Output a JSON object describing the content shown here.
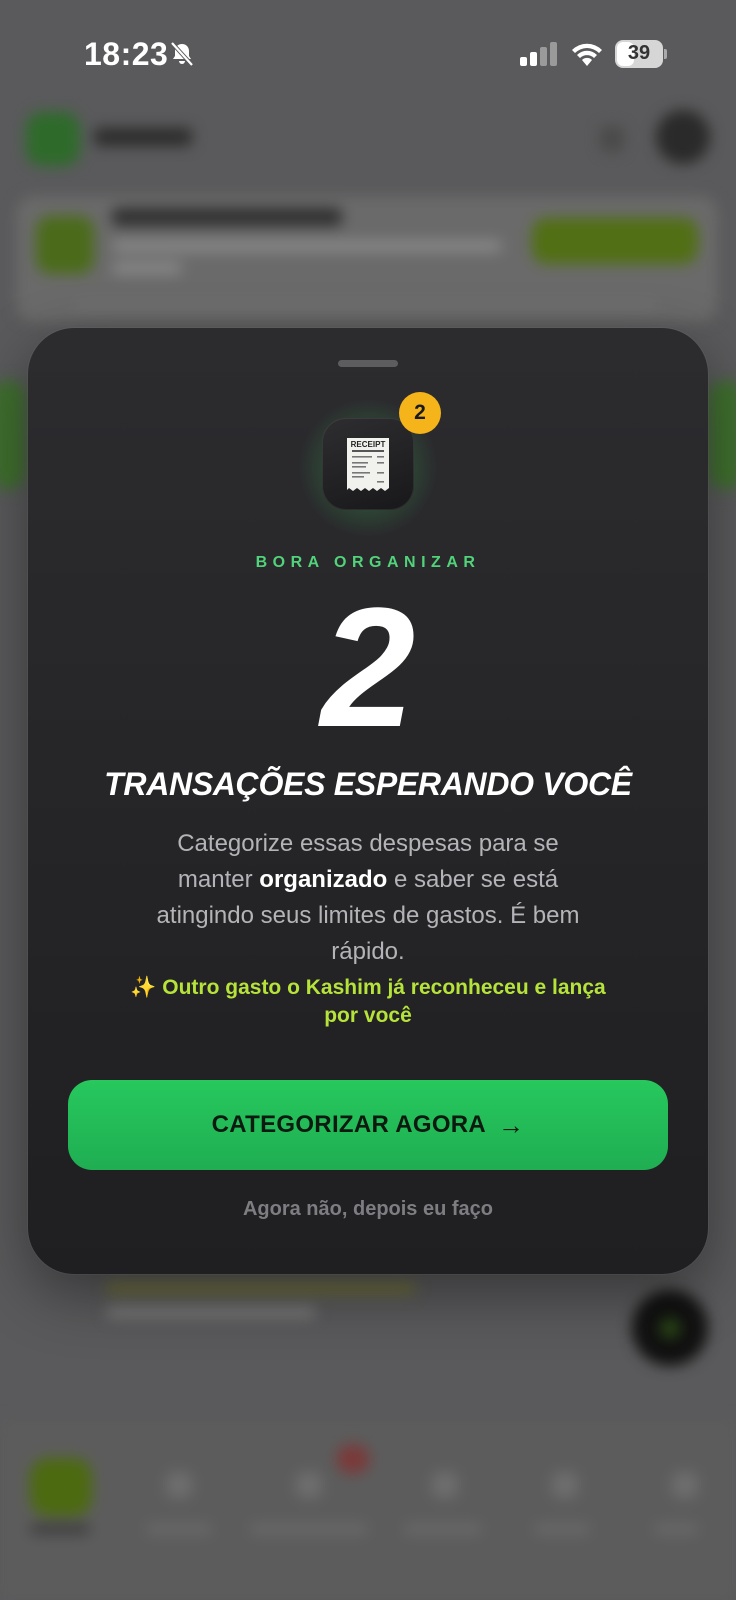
{
  "status_bar": {
    "time": "18:23",
    "battery_level": "39",
    "battery_fraction": 0.39,
    "icons": [
      "bell-slash-icon",
      "cellular-signal-icon",
      "wifi-icon",
      "battery-icon"
    ]
  },
  "modal": {
    "badge_count": "2",
    "receipt_icon_text": "RECEIPT",
    "eyebrow": "BORA ORGANIZAR",
    "big_number": "2",
    "headline": "TRANSAÇÕES ESPERANDO VOCÊ",
    "description": {
      "before": "Categorize essas despesas para se manter ",
      "bold": "organizado",
      "after": " e saber se está atingindo seus limites de gastos. É bem rápido."
    },
    "highlight": {
      "emoji": "✨",
      "text": "Outro gasto o Kashim já reconheceu e lança por você"
    },
    "primary_button": {
      "label": "CATEGORIZAR AGORA",
      "icon": "→"
    },
    "secondary_link": "Agora não, depois eu faço"
  },
  "colors": {
    "accent_green": "#52d27a",
    "button_green": "#22c55e",
    "highlight_lime": "#b6e33a",
    "badge_yellow": "#f4b41a",
    "modal_bg": "#232325"
  }
}
